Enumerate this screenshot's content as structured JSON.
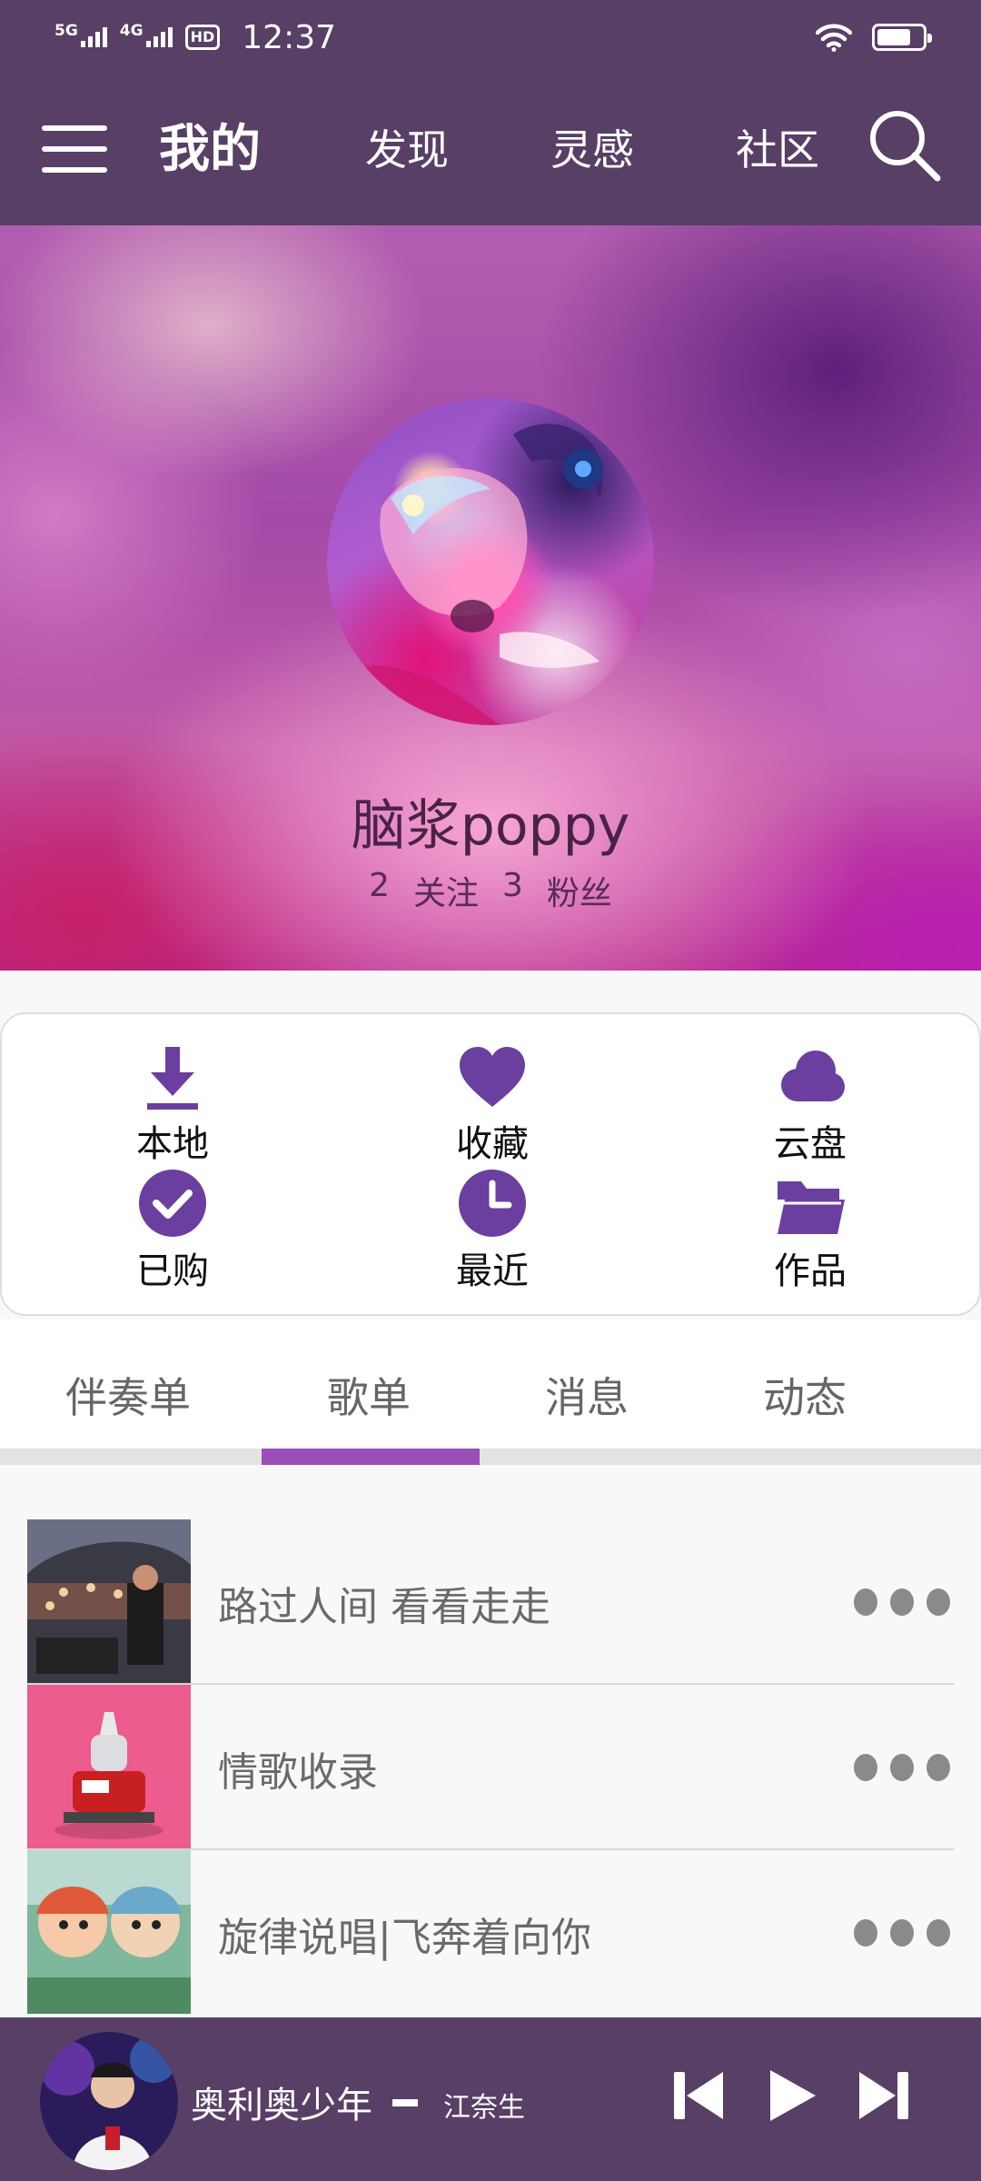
{
  "status_bar": {
    "signal1_label": "5G",
    "signal2_label": "4G",
    "hd_label": "HD",
    "time": "12:37",
    "battery_level": 0.75
  },
  "nav": {
    "tabs": [
      {
        "label": "我的",
        "active": true
      },
      {
        "label": "发现",
        "active": false
      },
      {
        "label": "灵感",
        "active": false
      },
      {
        "label": "社区",
        "active": false
      }
    ]
  },
  "profile": {
    "username": "脑浆poppy",
    "following_count": "2",
    "following_label": "关注",
    "followers_count": "3",
    "followers_label": "粉丝"
  },
  "quick_access": [
    {
      "label": "本地",
      "icon": "download-icon"
    },
    {
      "label": "收藏",
      "icon": "heart-icon"
    },
    {
      "label": "云盘",
      "icon": "cloud-icon"
    },
    {
      "label": "已购",
      "icon": "check-circle-icon"
    },
    {
      "label": "最近",
      "icon": "clock-icon"
    },
    {
      "label": "作品",
      "icon": "folder-icon"
    }
  ],
  "sub_tabs": [
    {
      "label": "伴奏单",
      "active": false
    },
    {
      "label": "歌单",
      "active": true
    },
    {
      "label": "消息",
      "active": false
    },
    {
      "label": "动态",
      "active": false
    }
  ],
  "playlists": [
    {
      "title": "路过人间 看看走走"
    },
    {
      "title": "情歌收录"
    },
    {
      "title": "旋律说唱|飞奔着向你"
    }
  ],
  "now_playing": {
    "title": "奥利奥少年",
    "artist": "江奈生"
  },
  "colors": {
    "bar_background": "#573f66",
    "accent": "#6b3f9f",
    "tab_indicator": "#9a4fb8"
  }
}
